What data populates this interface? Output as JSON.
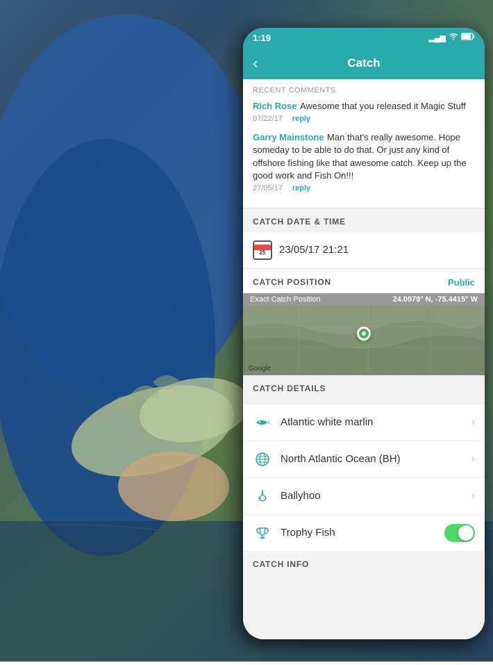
{
  "statusBar": {
    "time": "1:19",
    "locationIcon": "◂",
    "signalBars": "▂▄▆",
    "wifiIcon": "wifi",
    "batteryIcon": "battery"
  },
  "navBar": {
    "backLabel": "‹",
    "title": "Catch"
  },
  "comments": {
    "header": "RECENT COMMENTS",
    "items": [
      {
        "author": "Rich Rose",
        "text": " Awesome that you released it Magic Stuff",
        "date": "07/22/17",
        "replyLabel": "reply"
      },
      {
        "author": "Garry Mainstone",
        "text": " Man that's really awesome. Hope someday to be able to do that. Or just any kind of offshore fishing like that awesome catch. Keep up the good work and Fish On!!!",
        "date": "27/05/17",
        "replyLabel": "reply"
      }
    ]
  },
  "catchDateSection": {
    "title": "CATCH DATE & TIME",
    "calendarDay": "25",
    "datetime": "23/05/17 21:21"
  },
  "catchPositionSection": {
    "title": "CATCH POSITION",
    "publicLabel": "Public",
    "coordsLabel": "Exact Catch Position",
    "coordsValue": "24.0979° N, -75.4415° W",
    "googleWatermark": "Google"
  },
  "catchDetailsSection": {
    "title": "CATCH DETAILS",
    "items": [
      {
        "icon": "fish",
        "text": "Atlantic white marlin",
        "type": "chevron"
      },
      {
        "icon": "globe",
        "text": "North Atlantic Ocean (BH)",
        "type": "chevron"
      },
      {
        "icon": "bait",
        "text": "Ballyhoo",
        "type": "chevron"
      },
      {
        "icon": "trophy",
        "text": "Trophy Fish",
        "type": "toggle"
      }
    ]
  },
  "catchInfoSection": {
    "title": "CATCH INFO"
  }
}
